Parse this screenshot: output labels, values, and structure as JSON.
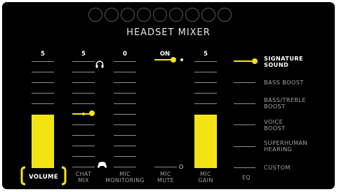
{
  "mixer": {
    "title": "HEADSET MIXER",
    "accent_color": "#f4e313",
    "page_dots": 9,
    "columns": [
      {
        "id": "volume",
        "label": "VOLUME",
        "value": "5",
        "level_fraction": 0.5,
        "selected": true
      },
      {
        "id": "chat-mix",
        "label": "CHAT\nMIX",
        "value": "5",
        "position_fraction": 0.5
      },
      {
        "id": "mic-monitoring",
        "label": "MIC\nMONITORING",
        "value": "0"
      },
      {
        "id": "mic-mute",
        "label": "MIC\nMUTE",
        "value": "ON",
        "toggle_on": true
      },
      {
        "id": "mic-gain",
        "label": "MIC\nGAIN",
        "value": "5",
        "level_fraction": 0.5
      },
      {
        "id": "eq",
        "label": "EQ"
      }
    ],
    "chat_mix_icons": {
      "top": "headset-icon",
      "bottom": "controller-icon"
    },
    "eq_presets": [
      {
        "label": "SIGNATURE\nSOUND",
        "active": true
      },
      {
        "label": "BASS BOOST",
        "active": false
      },
      {
        "label": "BASS/TREBLE\nBOOST",
        "active": false
      },
      {
        "label": "VOICE\nBOOST",
        "active": false
      },
      {
        "label": "SUPERHUMAN\nHEARING",
        "active": false
      },
      {
        "label": "CUSTOM",
        "active": false
      }
    ]
  }
}
